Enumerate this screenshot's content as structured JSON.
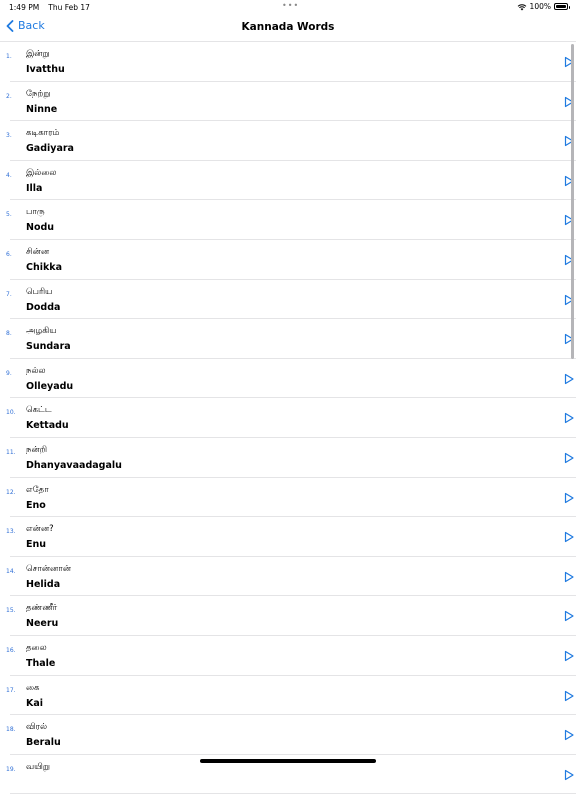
{
  "status": {
    "time": "1:49 PM",
    "date": "Thu Feb 17",
    "battery": "100%",
    "dots": "•••"
  },
  "nav": {
    "back_label": "Back",
    "title": "Kannada Words"
  },
  "colors": {
    "accent": "#1f7ae0"
  },
  "words": [
    {
      "num": "1.",
      "tamil": "இன்று",
      "kannada": "Ivatthu"
    },
    {
      "num": "2.",
      "tamil": "நேற்று",
      "kannada": "Ninne"
    },
    {
      "num": "3.",
      "tamil": "கடிகாரம்",
      "kannada": "Gadiyara"
    },
    {
      "num": "4.",
      "tamil": "இல்லை",
      "kannada": "Illa"
    },
    {
      "num": "5.",
      "tamil": "பாரு",
      "kannada": "Nodu"
    },
    {
      "num": "6.",
      "tamil": "சின்ன",
      "kannada": "Chikka"
    },
    {
      "num": "7.",
      "tamil": "பெரிய",
      "kannada": "Dodda"
    },
    {
      "num": "8.",
      "tamil": "அழகிய",
      "kannada": "Sundara"
    },
    {
      "num": "9.",
      "tamil": "நல்ல",
      "kannada": "Olleyadu"
    },
    {
      "num": "10.",
      "tamil": "கெட்ட",
      "kannada": "Kettadu"
    },
    {
      "num": "11.",
      "tamil": "நன்றி",
      "kannada": "Dhanyavaadagalu"
    },
    {
      "num": "12.",
      "tamil": "எதோ",
      "kannada": "Eno"
    },
    {
      "num": "13.",
      "tamil": "என்ன?",
      "kannada": "Enu"
    },
    {
      "num": "14.",
      "tamil": "சொன்னான்",
      "kannada": "Helida"
    },
    {
      "num": "15.",
      "tamil": "தண்ணீர்",
      "kannada": "Neeru"
    },
    {
      "num": "16.",
      "tamil": "தலை",
      "kannada": "Thale"
    },
    {
      "num": "17.",
      "tamil": "கை",
      "kannada": "Kai"
    },
    {
      "num": "18.",
      "tamil": "விரல்",
      "kannada": "Beralu"
    },
    {
      "num": "19.",
      "tamil": "வயிறு",
      "kannada": ""
    }
  ]
}
